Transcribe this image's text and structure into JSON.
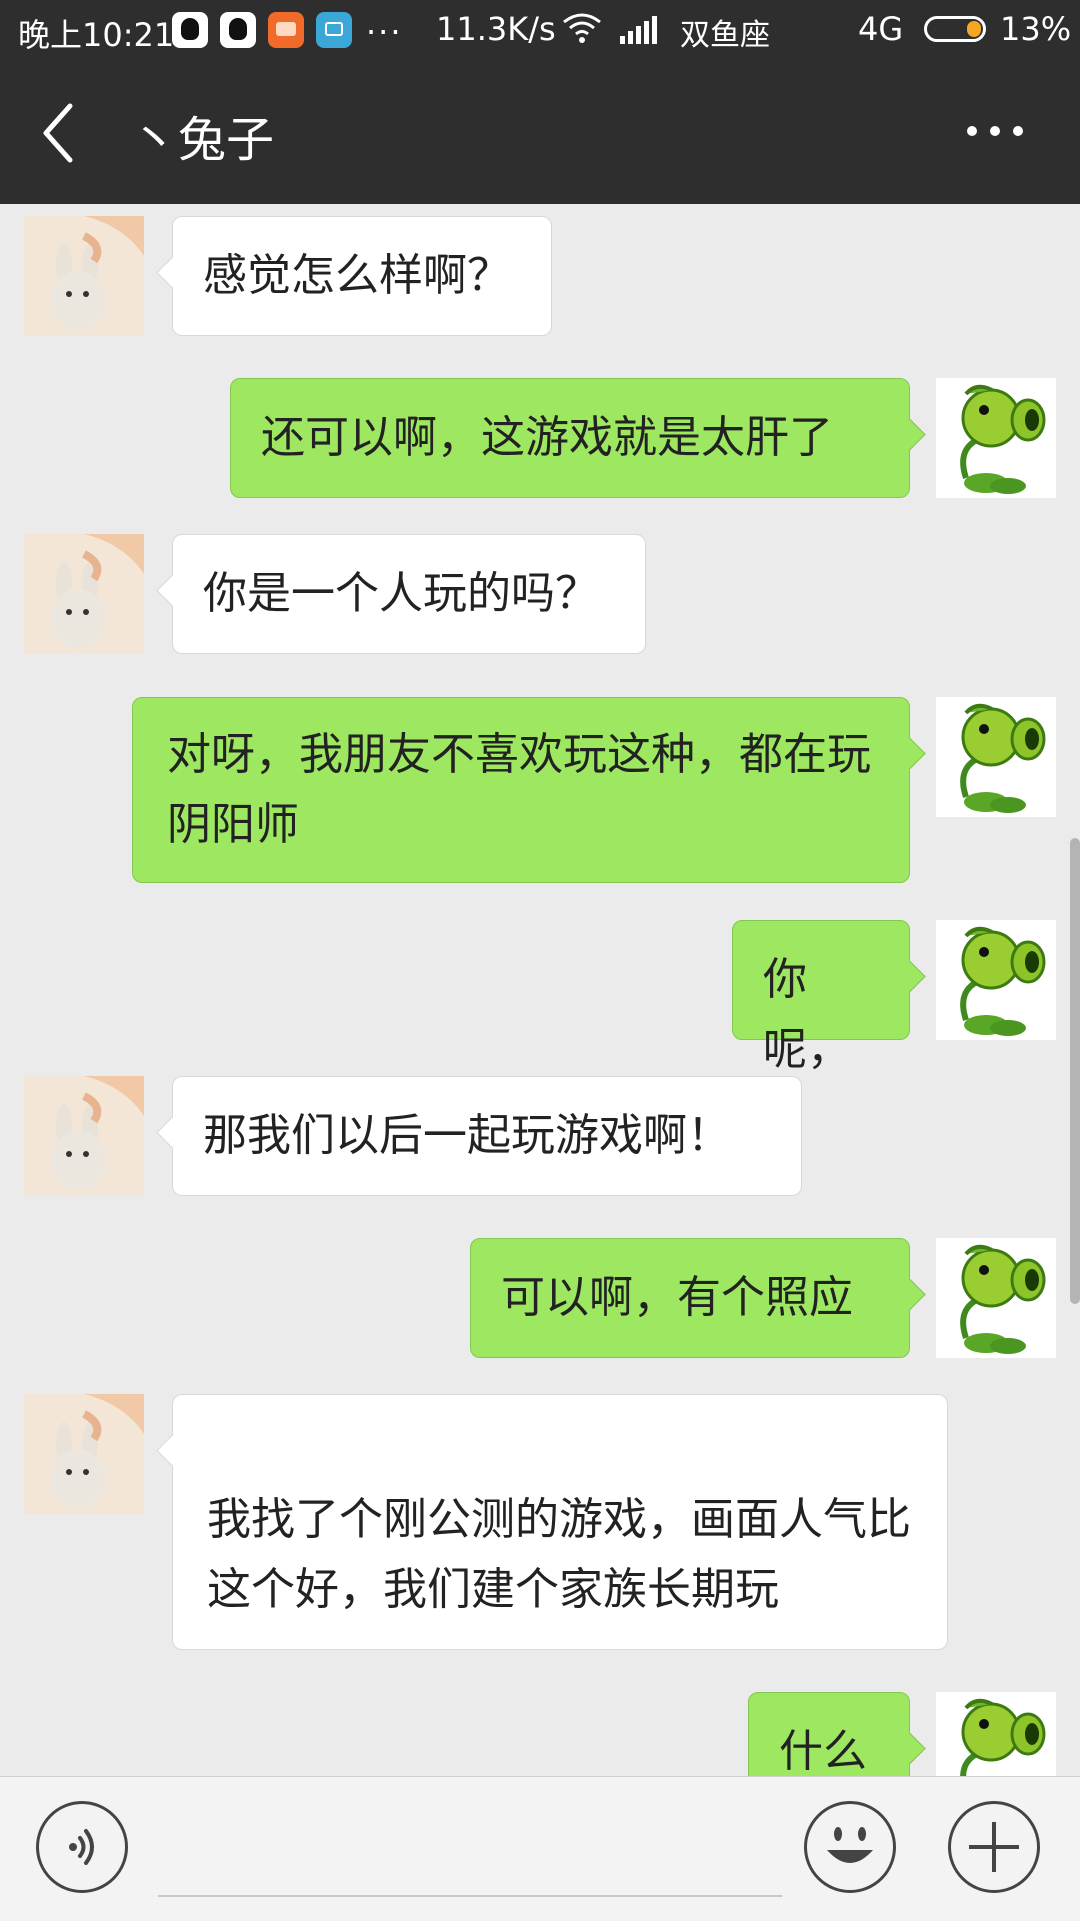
{
  "status_bar": {
    "time": "晚上10:21",
    "more": "...",
    "net_speed": "11.3K/s",
    "carrier": "双鱼座",
    "network": "4G",
    "battery": "13%",
    "battery_level": 0.13,
    "icons": [
      "qq-icon",
      "qq-icon",
      "taobao-icon",
      "app-icon",
      "wifi-icon",
      "signal-icon",
      "battery-icon"
    ]
  },
  "title_bar": {
    "title": "丶兔子",
    "icons": [
      "back-arrow-icon",
      "more-dots-icon"
    ]
  },
  "messages": [
    {
      "side": "in",
      "text": "感觉怎么样啊？"
    },
    {
      "side": "out",
      "text": "还可以啊，这游戏就是太肝了"
    },
    {
      "side": "in",
      "text": "你是一个人玩的吗？"
    },
    {
      "side": "out",
      "text": "对呀，我朋友不喜欢玩这种，都在玩阴阳师"
    },
    {
      "side": "out",
      "text": "你呢，"
    },
    {
      "side": "in",
      "text": "那我们以后一起玩游戏啊！"
    },
    {
      "side": "out",
      "text": "可以啊，有个照应"
    },
    {
      "side": "in",
      "text": "我找了个刚公测的游戏，画面人气比这个好，我们建个家族长期玩"
    },
    {
      "side": "out",
      "text": "什么"
    }
  ],
  "input_bar": {
    "value": "",
    "icons": [
      "voice-icon",
      "emoji-icon",
      "plus-icon"
    ]
  },
  "colors": {
    "header_bg": "#2e2e2e",
    "chat_bg": "#ebebeb",
    "outgoing_bubble": "#9ee760",
    "incoming_bubble": "#ffffff"
  }
}
